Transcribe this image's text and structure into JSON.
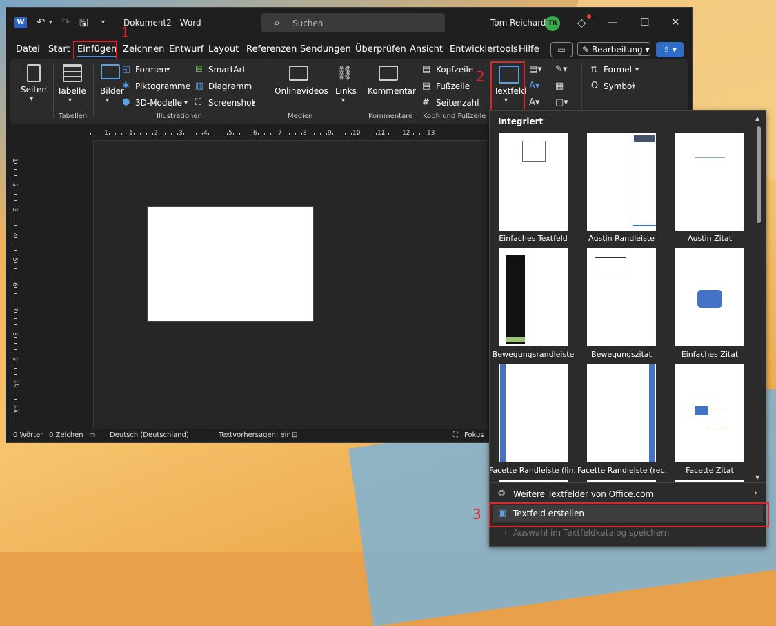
{
  "window": {
    "title": "Dokument2  -  Word",
    "search_placeholder": "Suchen",
    "user_name": "Tom Reichardt",
    "user_initials": "TR"
  },
  "menu": {
    "items": [
      "Datei",
      "Start",
      "Einfügen",
      "Zeichnen",
      "Entwurf",
      "Layout",
      "Referenzen",
      "Sendungen",
      "Überprüfen",
      "Ansicht",
      "Entwicklertools",
      "Hilfe"
    ],
    "active": "Einfügen",
    "edit_label": "Bearbeitung"
  },
  "ribbon": {
    "seiten": "Seiten",
    "tabelle": "Tabelle",
    "bilder": "Bilder",
    "formen": "Formen",
    "piktogramme": "Piktogramme",
    "modelle3d": "3D-Modelle",
    "smartart": "SmartArt",
    "diagramm": "Diagramm",
    "screenshot": "Screenshot",
    "onlinevideos": "Onlinevideos",
    "links": "Links",
    "kommentar": "Kommentar",
    "kopfzeile": "Kopfzeile",
    "fusszeile": "Fußzeile",
    "seitenzahl": "Seitenzahl",
    "textfeld": "Textfeld",
    "formel": "Formel",
    "symbol": "Symbol",
    "groups": {
      "tabellen": "Tabellen",
      "illustrationen": "Illustrationen",
      "medien": "Medien",
      "kommentare": "Kommentare",
      "kopf_fuss": "Kopf- und Fußzeile"
    }
  },
  "annotations": {
    "step1": "1",
    "step2": "2",
    "step3": "3"
  },
  "status": {
    "words": "0 Wörter",
    "chars": "0 Zeichen",
    "language": "Deutsch (Deutschland)",
    "prediction": "Textvorhersagen: ein",
    "focus": "Fokus"
  },
  "ruler": {
    "top": [
      "1",
      "1",
      "2",
      "3",
      "4",
      "5",
      "6",
      "7",
      "8",
      "9",
      "10",
      "11",
      "12",
      "13"
    ],
    "left": [
      "1",
      "2",
      "3",
      "4",
      "5",
      "6",
      "7",
      "8",
      "9",
      "10",
      "11"
    ]
  },
  "gallery": {
    "heading": "Integriert",
    "thumbs": [
      "Einfaches Textfeld",
      "Austin Randleiste",
      "Austin Zitat",
      "Bewegungsrandleiste",
      "Bewegungszitat",
      "Einfaches Zitat",
      "Facette Randleiste (lin...",
      "Facette Randleiste (rec...",
      "Facette Zitat"
    ],
    "more": "Weitere Textfelder von Office.com",
    "create": "Textfeld erstellen",
    "save": "Auswahl im Textfeldkatalog speichern"
  },
  "colors": {
    "accent": "#2f6cc8",
    "highlight": "#e0242c"
  }
}
